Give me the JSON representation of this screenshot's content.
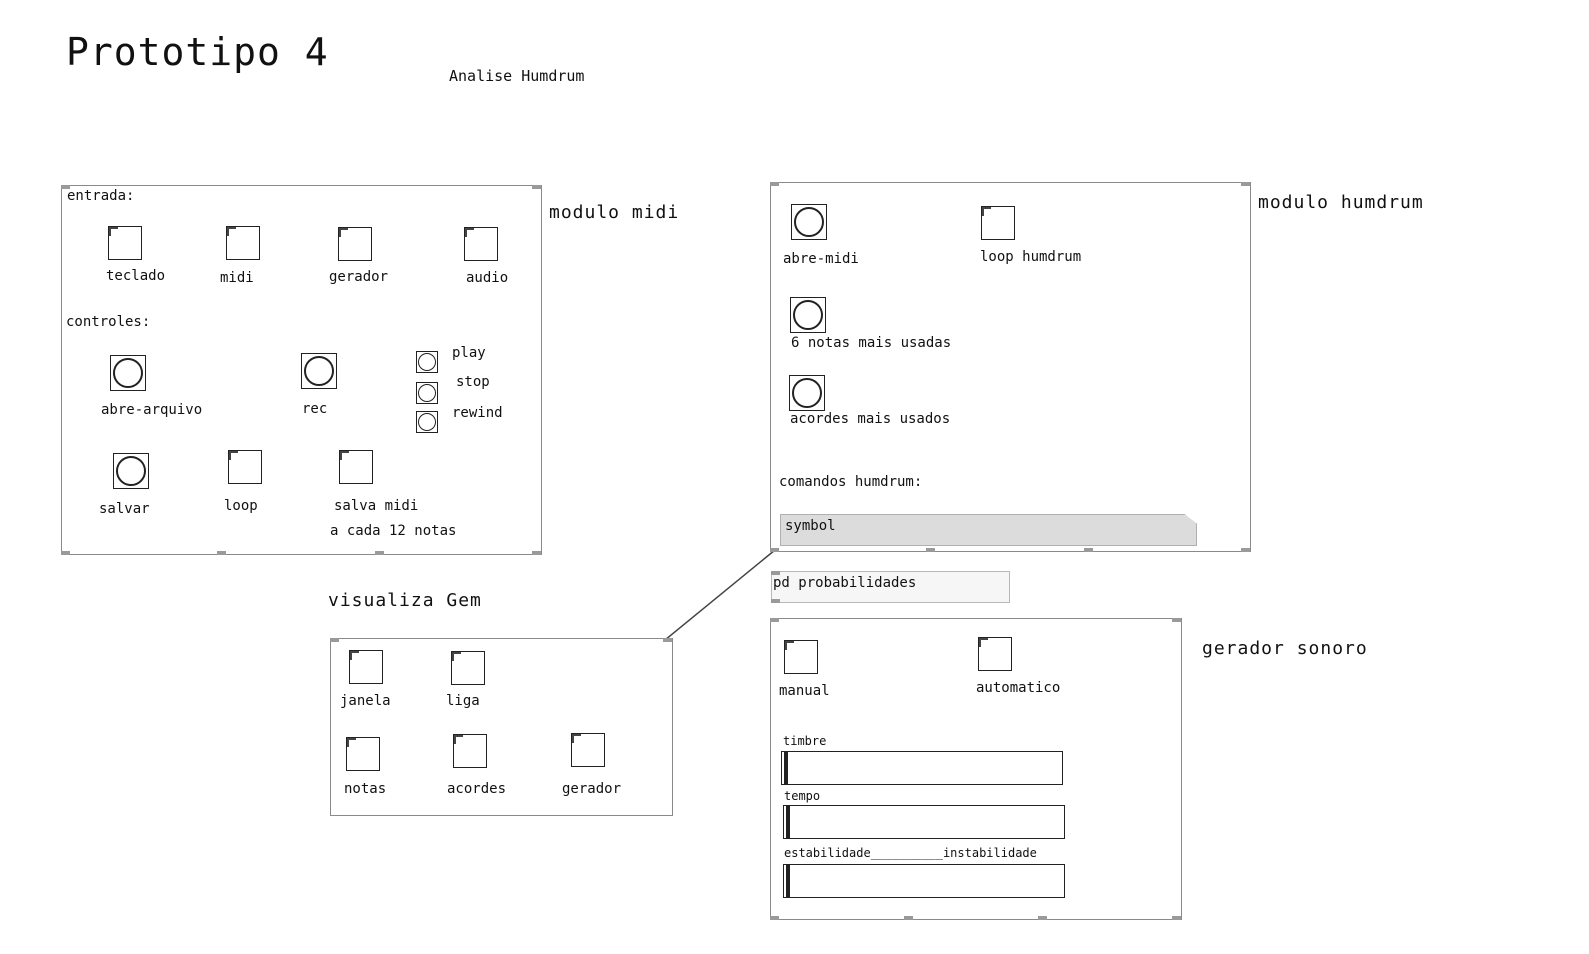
{
  "title": "Prototipo 4",
  "subtitle": "Analise Humdrum",
  "modulo_midi": {
    "label": "modulo midi",
    "entrada_label": "entrada:",
    "entrada": [
      "teclado",
      "midi",
      "gerador",
      "audio"
    ],
    "controles_label": "controles:",
    "bangs": [
      "abre-arquivo",
      "rec"
    ],
    "transport": [
      "play",
      "stop",
      "rewind"
    ],
    "salvar": "salvar",
    "loop": "loop",
    "salva_midi": "salva midi",
    "salva_midi_note": "a cada 12 notas"
  },
  "modulo_humdrum": {
    "label": "modulo humdrum",
    "abre_midi": "abre-midi",
    "loop_humdrum": "loop humdrum",
    "notas": "6 notas mais usadas",
    "acordes": "acordes mais usados",
    "comandos_label": "comandos humdrum:",
    "symbol": "symbol"
  },
  "pd_object": "pd probabilidades",
  "visualiza": {
    "label": "visualiza Gem",
    "toggles": [
      "janela",
      "liga",
      "notas",
      "acordes",
      "gerador"
    ]
  },
  "gerador_sonoro": {
    "label": "gerador sonoro",
    "manual": "manual",
    "automatico": "automatico",
    "timbre": "timbre",
    "tempo": "tempo",
    "estabilidade": "estabilidade__________instabilidade"
  }
}
